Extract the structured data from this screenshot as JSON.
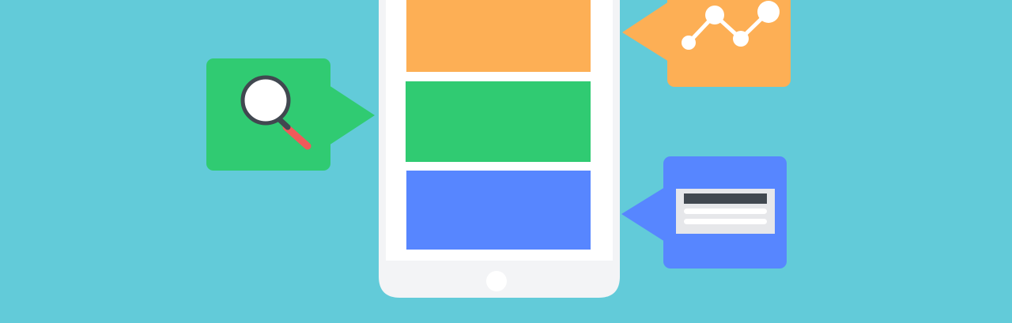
{
  "colors": {
    "background": "#62CBD9",
    "phone_body": "#F3F4F6",
    "phone_screen": "#FFFFFF",
    "block_orange": "#FDAF55",
    "block_green": "#30CB72",
    "block_blue": "#5786FF",
    "home_button": "#FFFFFF",
    "icon_dark": "#414850",
    "icon_light": "#FFFFFF",
    "icon_red": "#F05A5A",
    "card_paper": "#E6E7EA"
  },
  "phone": {
    "content_blocks": [
      "orange-block",
      "green-block",
      "blue-block"
    ]
  },
  "bubbles": [
    {
      "name": "search-bubble",
      "color_key": "block_green",
      "icon": "magnifier-icon"
    },
    {
      "name": "analytics-bubble",
      "color_key": "block_orange",
      "icon": "line-chart-icon"
    },
    {
      "name": "document-bubble",
      "color_key": "block_blue",
      "icon": "document-card-icon"
    }
  ]
}
